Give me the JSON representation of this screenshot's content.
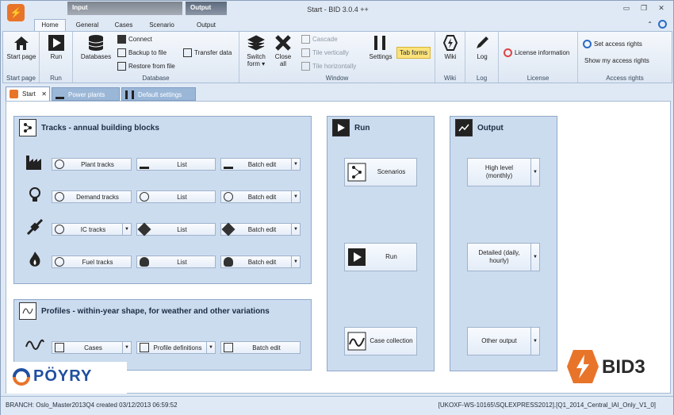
{
  "app": {
    "title": "Start - BID 3.0.4 ++"
  },
  "context_tabs": {
    "input": "Input",
    "output": "Output"
  },
  "ribbon_tabs": [
    "Home",
    "General",
    "Cases",
    "Scenario",
    "Output"
  ],
  "ribbon": {
    "start_page": {
      "label": "Start page",
      "group": "Start page"
    },
    "run": {
      "label": "Run",
      "group": "Run"
    },
    "database": {
      "group": "Database",
      "databases": "Databases",
      "connect": "Connect",
      "backup": "Backup to file",
      "restore": "Restore from file",
      "transfer": "Transfer data"
    },
    "window": {
      "group": "Window",
      "switch_form": "Switch form",
      "close_all": "Close all",
      "cascade": "Cascade",
      "tile_v": "Tile vertically",
      "tile_h": "Tile horizontally",
      "settings": "Settings",
      "tab_forms": "Tab forms"
    },
    "wiki": {
      "label": "Wiki",
      "group": "Wiki"
    },
    "log": {
      "label": "Log",
      "group": "Log"
    },
    "license": {
      "label": "License information",
      "group": "License"
    },
    "access": {
      "set": "Set access rights",
      "show": "Show my access rights",
      "group": "Access rights"
    }
  },
  "doc_tabs": [
    "Start",
    "Power plants",
    "Default settings"
  ],
  "tracks": {
    "title": "Tracks - annual building blocks",
    "rows": [
      {
        "name": "Plant tracks",
        "list": "List",
        "batch": "Batch edit"
      },
      {
        "name": "Demand tracks",
        "list": "List",
        "batch": "Batch edit"
      },
      {
        "name": "IC tracks",
        "list": "List",
        "batch": "Batch edit"
      },
      {
        "name": "Fuel tracks",
        "list": "List",
        "batch": "Batch edit"
      }
    ]
  },
  "profiles": {
    "title": "Profiles - within-year shape, for weather and other variations",
    "cases": "Cases",
    "definitions": "Profile definitions",
    "batch": "Batch edit"
  },
  "run_panel": {
    "title": "Run",
    "scenarios": "Scenarios",
    "run": "Run",
    "case_collection": "Case collection"
  },
  "output_panel": {
    "title": "Output",
    "high_level": "High level (monthly)",
    "detailed": "Detailed (daily, hourly)",
    "other": "Other output"
  },
  "logos": {
    "poyry": "PÖYRY",
    "bid3": "BID3"
  },
  "status": {
    "left": "BRANCH: Oslo_Master2013Q4 created 03/12/2013 06:59:52",
    "right": "[UKOXF-WS-10165\\SQLEXPRESS2012].[Q1_2014_Central_IAI_Only_V1_0]"
  },
  "colors": {
    "accent": "#e8742a",
    "panel": "#ccdcef",
    "ribbon_group_label": "#3a4a5e"
  }
}
